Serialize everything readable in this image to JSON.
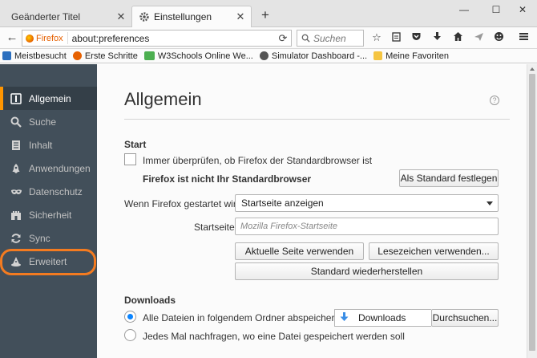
{
  "tabs": [
    {
      "label": "Geänderter Titel",
      "active": false
    },
    {
      "label": "Einstellungen",
      "active": true
    }
  ],
  "window": {
    "minimize": "—",
    "maximize": "☐",
    "close": "✕"
  },
  "navbar": {
    "identity_label": "Firefox",
    "url": "about:preferences",
    "search_placeholder": "Suchen"
  },
  "bookmarks": [
    {
      "label": "Meistbesucht",
      "color": "#2b6fbf"
    },
    {
      "label": "Erste Schritte",
      "color": "#e66000"
    },
    {
      "label": "W3Schools Online We...",
      "color": "#4caf50"
    },
    {
      "label": "Simulator Dashboard -...",
      "color": "#555555"
    },
    {
      "label": "Meine Favoriten",
      "color": "#f5c542"
    }
  ],
  "sidebar": {
    "items": [
      {
        "label": "Allgemein",
        "icon": "general-icon",
        "selected": true
      },
      {
        "label": "Suche",
        "icon": "search-icon",
        "selected": false
      },
      {
        "label": "Inhalt",
        "icon": "content-icon",
        "selected": false
      },
      {
        "label": "Anwendungen",
        "icon": "rocket-icon",
        "selected": false
      },
      {
        "label": "Datenschutz",
        "icon": "mask-icon",
        "selected": false
      },
      {
        "label": "Sicherheit",
        "icon": "castle-icon",
        "selected": false
      },
      {
        "label": "Sync",
        "icon": "sync-icon",
        "selected": false
      },
      {
        "label": "Erweitert",
        "icon": "wizard-hat-icon",
        "selected": false
      }
    ],
    "accent_color": "#ff9500",
    "highlight_ring_color": "#f47b20"
  },
  "main": {
    "title": "Allgemein",
    "start": {
      "heading": "Start",
      "check_default_label": "Immer überprüfen, ob Firefox der Standardbrowser ist",
      "not_default_text": "Firefox ist nicht Ihr Standardbrowser",
      "set_default_button": "Als Standard festlegen",
      "on_start_label": "Wenn Firefox gestartet wird:",
      "on_start_value": "Startseite anzeigen",
      "homepage_label": "Startseite:",
      "homepage_placeholder": "Mozilla Firefox-Startseite",
      "use_current_button": "Aktuelle Seite verwenden",
      "use_bookmark_button": "Lesezeichen verwenden...",
      "restore_default_button": "Standard wiederherstellen"
    },
    "downloads": {
      "heading": "Downloads",
      "save_to_label": "Alle Dateien in folgendem Ordner abspeichern:",
      "folder_name": "Downloads",
      "browse_button": "Durchsuchen...",
      "ask_label": "Jedes Mal nachfragen, wo eine Datei gespeichert werden soll"
    }
  }
}
